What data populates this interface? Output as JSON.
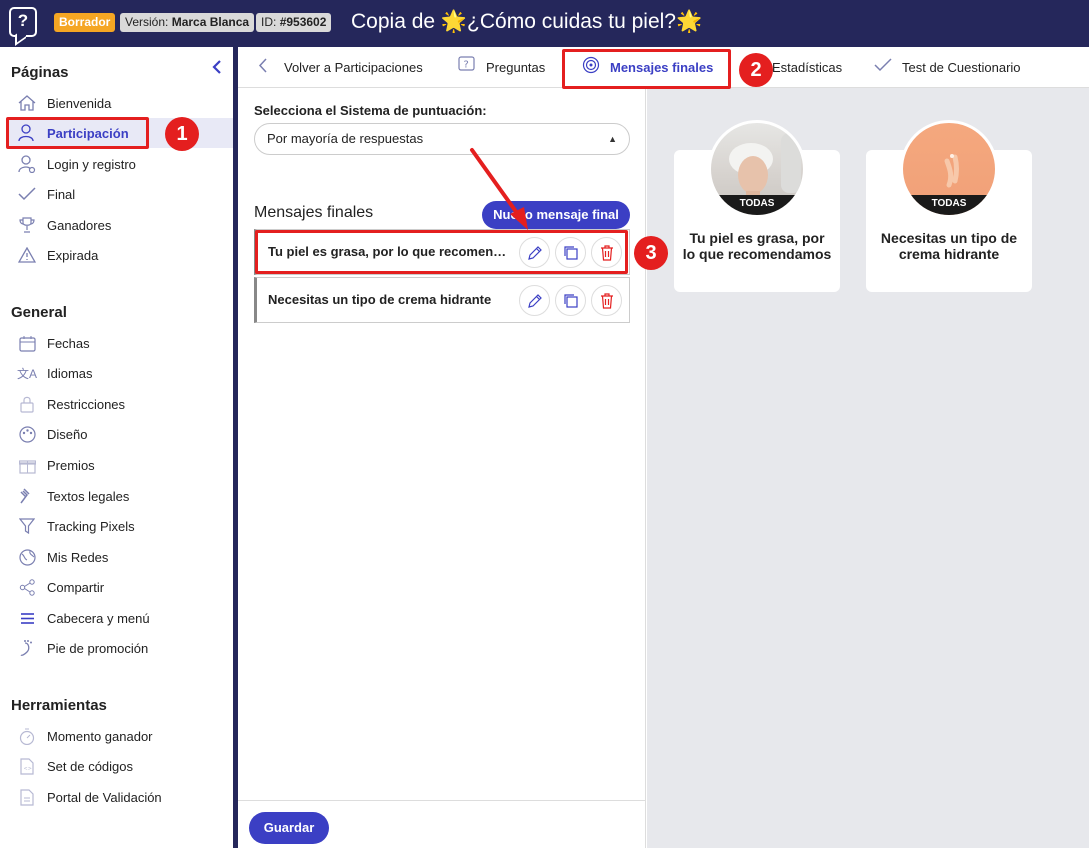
{
  "header": {
    "draft_badge": "Borrador",
    "version_label": "Versión:",
    "version_value": "Marca Blanca",
    "id_label": "ID:",
    "id_value": "#953602",
    "title": "Copia de 🌟¿Cómo cuidas tu piel?🌟"
  },
  "sidebar": {
    "pages_title": "Páginas",
    "pages": [
      {
        "label": "Bienvenida",
        "icon": "home-icon"
      },
      {
        "label": "Participación",
        "icon": "user-share-icon",
        "active": true
      },
      {
        "label": "Login y registro",
        "icon": "user-settings-icon"
      },
      {
        "label": "Final",
        "icon": "check-icon"
      },
      {
        "label": "Ganadores",
        "icon": "trophy-icon"
      },
      {
        "label": "Expirada",
        "icon": "warning-icon"
      }
    ],
    "general_title": "General",
    "general": [
      {
        "label": "Fechas",
        "icon": "calendar-icon"
      },
      {
        "label": "Idiomas",
        "icon": "translate-icon"
      },
      {
        "label": "Restricciones",
        "icon": "lock-icon"
      },
      {
        "label": "Diseño",
        "icon": "palette-icon"
      },
      {
        "label": "Premios",
        "icon": "gift-icon"
      },
      {
        "label": "Textos legales",
        "icon": "gavel-icon"
      },
      {
        "label": "Tracking Pixels",
        "icon": "filter-icon"
      },
      {
        "label": "Mis Redes",
        "icon": "globe-icon"
      },
      {
        "label": "Compartir",
        "icon": "share-icon"
      },
      {
        "label": "Cabecera y menú",
        "icon": "menu-icon"
      },
      {
        "label": "Pie de promoción",
        "icon": "footprint-icon"
      }
    ],
    "tools_title": "Herramientas",
    "tools": [
      {
        "label": "Momento ganador",
        "icon": "stopwatch-icon"
      },
      {
        "label": "Set de códigos",
        "icon": "code-file-icon"
      },
      {
        "label": "Portal de Validación",
        "icon": "document-icon"
      }
    ]
  },
  "tabs": {
    "back": "Volver a Participaciones",
    "questions": "Preguntas",
    "final_messages": "Mensajes finales",
    "stats": "Estadísticas",
    "quiz_test": "Test de Cuestionario"
  },
  "form": {
    "scoring_label": "Selecciona el Sistema de puntuación:",
    "scoring_value": "Por mayoría de respuestas",
    "messages_title": "Mensajes finales",
    "new_button": "Nuevo mensaje final",
    "messages": [
      {
        "text": "Tu piel es grasa, por lo que recomendamos"
      },
      {
        "text": "Necesitas un tipo de crema hidrante"
      }
    ],
    "save_button": "Guardar"
  },
  "preview": {
    "cards": [
      {
        "badge": "TODAS",
        "text": "Tu piel es grasa, por lo que recomendamos"
      },
      {
        "badge": "TODAS",
        "text": "Necesitas un tipo de crema hidrante"
      }
    ]
  },
  "annotations": {
    "step1": "1",
    "step2": "2",
    "step3": "3",
    "color": "#e41f1f"
  },
  "colors": {
    "header_bg": "#25275b",
    "accent": "#3b3fc4",
    "draft": "#f5a623",
    "preview_bg": "#e7e8ec"
  }
}
